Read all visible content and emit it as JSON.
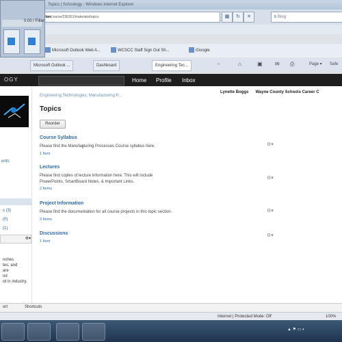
{
  "browser": {
    "window_title": "Topics | Schoology - Windows Internet Explorer",
    "address_host": "llon",
    "address_path": "/course/236301/materials/topics",
    "search_placeholder": "Bing",
    "fav_items": [
      "Microsoft Outlook Web A...",
      "WCSCC Staff Sign Out Sh...",
      "iGoogle"
    ],
    "tabs": [
      "Microsoft Outlook ...",
      "Dashboard",
      "Engineering Tec..."
    ],
    "tools": {
      "page_label": "Page",
      "safety_label": "Safe"
    }
  },
  "recorder": {
    "label": "0:00 / Filter"
  },
  "app": {
    "logo_text": "OGY",
    "nav": [
      "Home",
      "Profile",
      "Inbox"
    ]
  },
  "user": {
    "name": "Lynette Boggs",
    "school": "Wayne County Schools Career C"
  },
  "page": {
    "breadcrumb": "Engineering Technologies: Manufacturing P...",
    "title": "Topics",
    "reorder_label": "Reorder"
  },
  "folders": [
    {
      "title": "Course Syllabus",
      "desc": "Please find the Manufacturing Processes Course syllabus here.",
      "link": "1 Item"
    },
    {
      "title": "Lectures",
      "desc": "Please find copies of lecture information here. This will include",
      "desc2": "PowerPoints, SmartBoard Notes, & Important Links.",
      "link": "2 Items"
    },
    {
      "title": "Project Information",
      "desc": "Please find the documentation for all course projects in this topic section.",
      "link": "3 Items"
    },
    {
      "title": "Discussions",
      "desc": "",
      "link": "1 Item"
    }
  ],
  "left_panel": {
    "items": [
      "ents",
      "",
      "",
      ""
    ],
    "counts": [
      "s (3)",
      "(0)",
      "(1)"
    ],
    "desc_lines": [
      "nches",
      "tes, and",
      "are",
      "nd",
      "rd in industry."
    ]
  },
  "bottom_tabs": [
    "ort",
    "Shortcuts"
  ],
  "status": {
    "text": "Internet | Protected Mode: Off",
    "zoom": "100%"
  },
  "colors": {
    "link": "#2e6aa7",
    "header_bg": "#1e1e1e",
    "taskbar": "#2a4563"
  }
}
